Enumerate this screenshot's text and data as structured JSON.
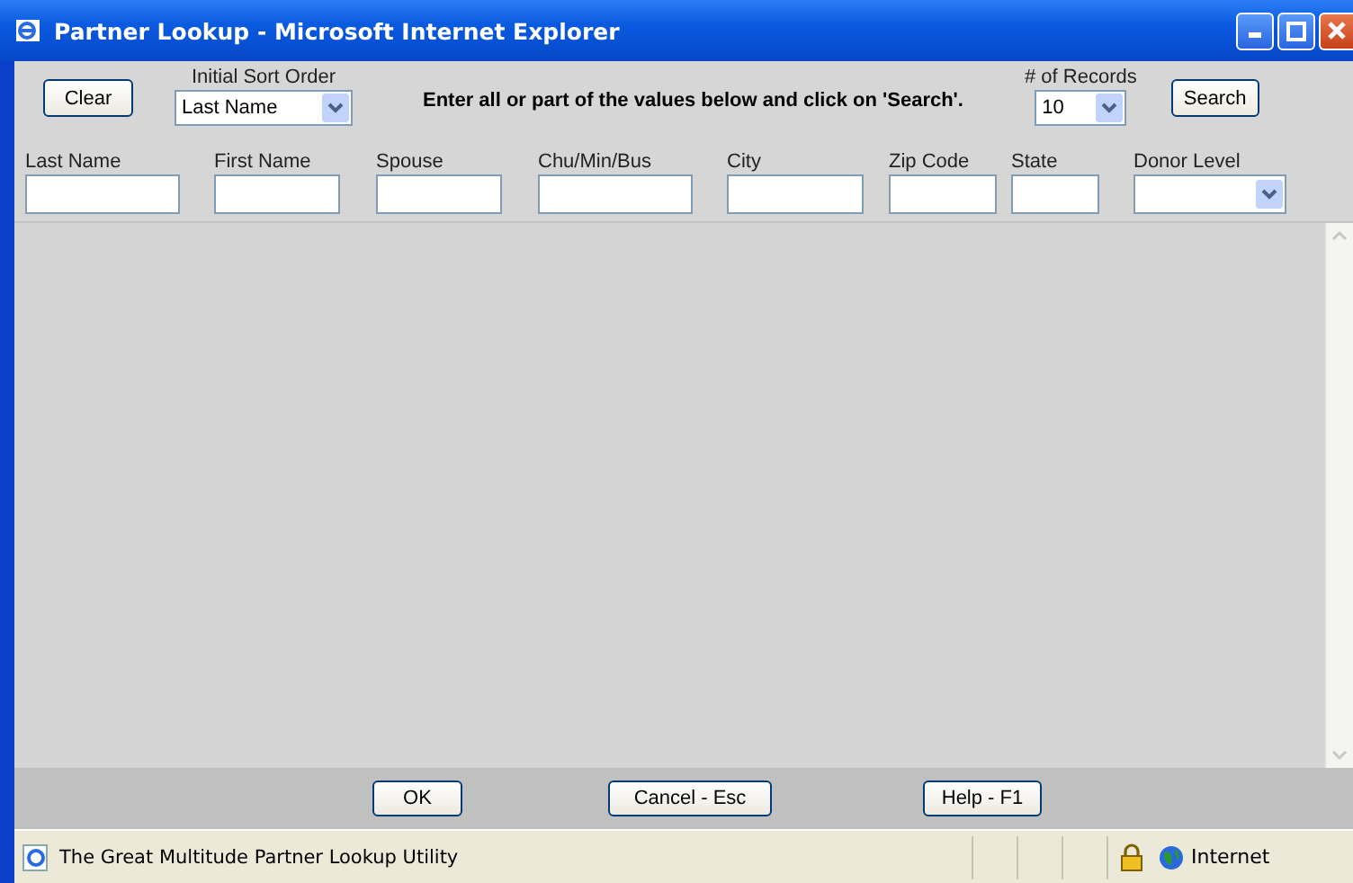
{
  "window": {
    "title": "Partner Lookup - Microsoft Internet Explorer"
  },
  "toolbar": {
    "clear_button": "Clear",
    "sort": {
      "label": "Initial Sort Order",
      "value": "Last Name"
    },
    "instructions": "Enter all or part of the values below and click on 'Search'.",
    "records": {
      "label": "# of Records",
      "value": "10"
    },
    "search_button": "Search"
  },
  "fields": [
    {
      "kind": "text",
      "label": "Last Name"
    },
    {
      "kind": "text",
      "label": "First Name"
    },
    {
      "kind": "text",
      "label": "Spouse"
    },
    {
      "kind": "text",
      "label": "Chu/Min/Bus"
    },
    {
      "kind": "text",
      "label": "City"
    },
    {
      "kind": "text",
      "label": "Zip Code"
    },
    {
      "kind": "text",
      "label": "State"
    },
    {
      "kind": "select",
      "label": "Donor Level"
    }
  ],
  "buttons": [
    "OK",
    "Cancel - Esc",
    "Help - F1"
  ],
  "status_bar": {
    "text": "The Great Multitude Partner Lookup Utility",
    "zone": "Internet"
  }
}
